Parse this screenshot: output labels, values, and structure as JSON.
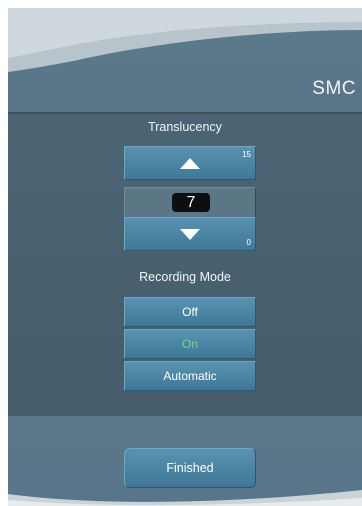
{
  "header": {
    "title": "SMC"
  },
  "translucency": {
    "label": "Translucency",
    "value": "7",
    "max": "15",
    "min": "0"
  },
  "recording_mode": {
    "label": "Recording Mode",
    "options": [
      "Off",
      "On",
      "Automatic"
    ],
    "selected": "On"
  },
  "footer": {
    "finished_label": "Finished"
  },
  "colors": {
    "panel": "#4a6272",
    "button": "#4a83a4",
    "selected_text": "#69e06d"
  }
}
